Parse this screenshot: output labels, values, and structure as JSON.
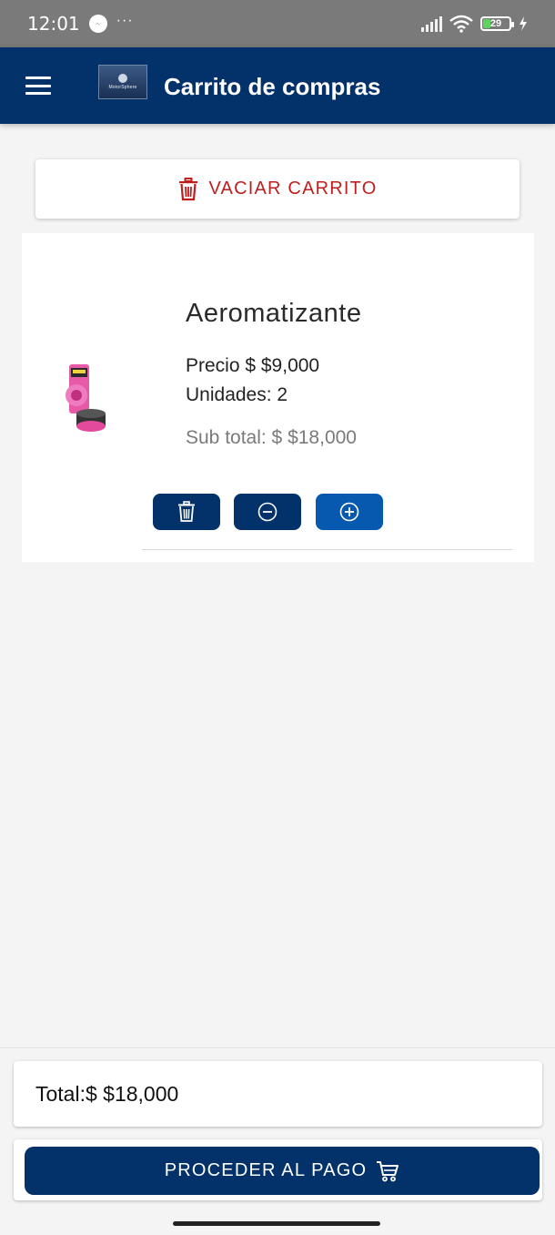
{
  "status_bar": {
    "time": "12:01",
    "dots": "···",
    "battery_level": "29",
    "battery_color": "#5ed35e"
  },
  "app_bar": {
    "title": "Carrito de compras",
    "logo_text": "MotorSphere",
    "background": "#03316a"
  },
  "cart": {
    "empty_button_label": "VACIAR CARRITO",
    "items": [
      {
        "name": "Aeromatizante",
        "price": "Precio $ $9,000",
        "units": "Unidades: 2",
        "subtotal": "Sub total: $ $18,000",
        "icon": "air-freshener-image"
      }
    ]
  },
  "icons": {
    "menu": "menu-icon",
    "trash": "trash-icon",
    "minus": "minus-circle-icon",
    "plus": "plus-circle-icon",
    "cart": "cart-icon"
  },
  "colors": {
    "primary": "#03316a",
    "accent": "#0759b0",
    "danger": "#c01e1e"
  },
  "footer": {
    "total": "Total:$ $18,000",
    "checkout_label": "PROCEDER AL PAGO"
  }
}
